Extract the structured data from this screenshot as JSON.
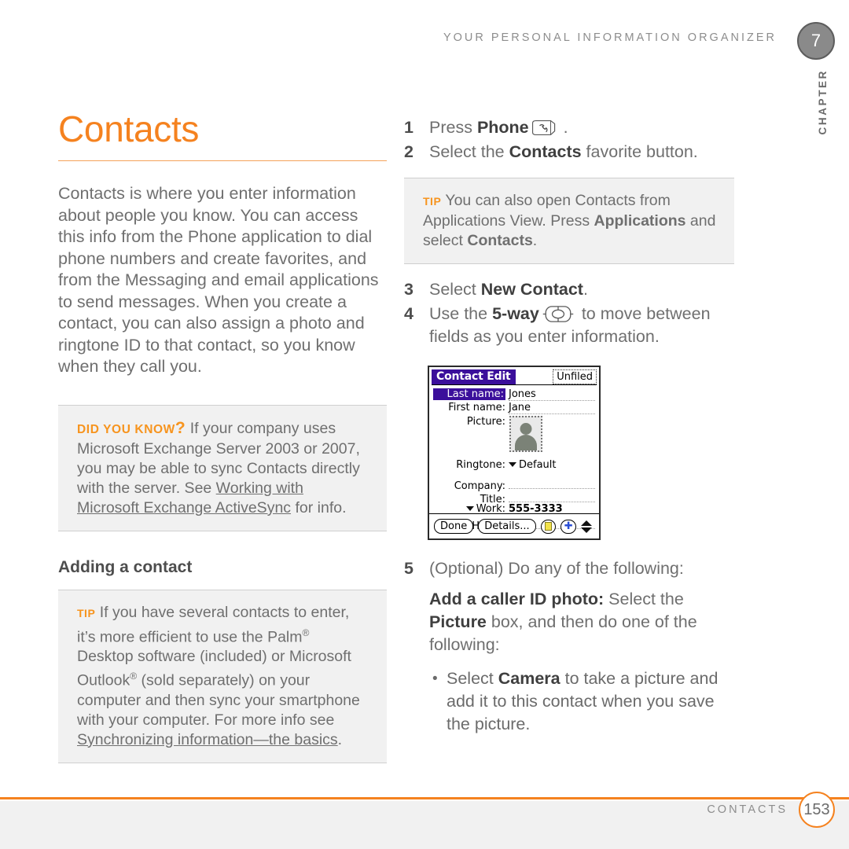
{
  "header": {
    "running_head": "YOUR PERSONAL INFORMATION ORGANIZER",
    "chapter_number": "7",
    "chapter_word": "CHAPTER"
  },
  "colors": {
    "accent_orange": "#F5821F",
    "marker_orange": "#F7941E",
    "body_gray": "#6f6f6f",
    "callout_bg": "#f1f1f1",
    "device_title_purple": "#3b0f9b"
  },
  "left_column": {
    "title": "Contacts",
    "intro": "Contacts is where you enter information about people you know. You can access this info from the Phone application to dial phone numbers and create favorites, and from the Messaging and email applications to send messages. When you create a contact, you can also assign a photo and ringtone ID to that contact, so you know when they call you.",
    "did_you_know": {
      "marker": "DID YOU KNOW",
      "marker_question": "?",
      "text_before": "If your company uses Microsoft Exchange Server 2003 or 2007, you may be able to sync Contacts directly with the server. See ",
      "xref": "Working with Microsoft Exchange ActiveSync",
      "text_after": " for info."
    },
    "subhead": "Adding a contact",
    "tip": {
      "marker": "TIP",
      "text_before": "If you have several contacts to enter, it’s more efficient to use the Palm",
      "reg1": "®",
      "text_mid1": " Desktop software (included) or Microsoft Outlook",
      "reg2": "®",
      "text_mid2": " (sold separately) on your computer and then sync your smartphone with your computer. For more info see ",
      "xref": "Synchronizing information—the basics",
      "text_after": "."
    }
  },
  "right_column": {
    "steps": [
      {
        "num": "1",
        "prefix": "Press ",
        "bold": "Phone",
        "icon": "phone-key-icon",
        "suffix": " ."
      },
      {
        "num": "2",
        "prefix": "Select the ",
        "bold": "Contacts",
        "suffix": " favorite button."
      },
      {
        "num": "3",
        "prefix": "Select ",
        "bold": "New Contact",
        "suffix": "."
      },
      {
        "num": "4",
        "prefix": "Use the ",
        "bold": "5-way",
        "icon": "five-way-navigator-icon",
        "suffix": " to move between fields as you enter information."
      },
      {
        "num": "5",
        "prefix": "(Optional)  Do any of the following:",
        "bold": "",
        "suffix": ""
      }
    ],
    "tip": {
      "marker": "TIP",
      "text_before": "You can also open Contacts from Applications View. Press ",
      "bold1": "Applications",
      "text_mid": " and select ",
      "bold2": "Contacts",
      "text_after": "."
    },
    "optional_block": {
      "bold_lead": "Add a caller ID photo:",
      "text_mid1": " Select the ",
      "bold2": "Picture",
      "text_mid2": " box, and then do one of the following:"
    },
    "bullet": {
      "dot": "•",
      "text_before": "Select ",
      "bold": "Camera",
      "text_after": " to take a picture and add it to this contact when you save the picture."
    }
  },
  "device_screen": {
    "title": "Contact Edit",
    "category": "Unfiled",
    "fields": [
      {
        "label": "Last name:",
        "value": "Jones",
        "selected": true,
        "caret": false
      },
      {
        "label": "First name:",
        "value": "Jane",
        "selected": false,
        "caret": false
      },
      {
        "label": "Picture:",
        "value": "",
        "selected": false,
        "caret": false
      },
      {
        "label": "Ringtone:",
        "value": "Default",
        "selected": false,
        "caret": true
      },
      {
        "label": "Company:",
        "value": "",
        "selected": false,
        "caret": false
      },
      {
        "label": "Title:",
        "value": "",
        "selected": false,
        "caret": false
      },
      {
        "label": "Work:",
        "value": "555-3333",
        "selected": false,
        "caret": true
      },
      {
        "label": "Home:",
        "value": "",
        "selected": false,
        "caret": true
      }
    ],
    "buttons": {
      "done": "Done",
      "details": "Details...",
      "note_icon": "note-icon",
      "add_icon": "plus-icon",
      "scroll_icon": "scroll-arrows-icon"
    },
    "avatar": "contact-photo-placeholder-icon"
  },
  "footer": {
    "label": "CONTACTS",
    "page_number": "153"
  }
}
